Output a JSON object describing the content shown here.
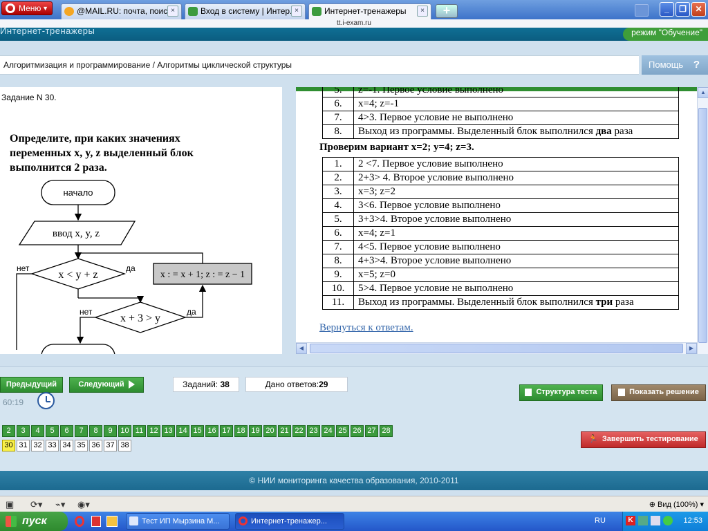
{
  "browser": {
    "menu_label": "Меню",
    "tabs": [
      {
        "label": "@MAIL.RU: почта, поис...",
        "close": "×"
      },
      {
        "label": "Вход в систему | Интер...",
        "close": "×"
      },
      {
        "label": "Интернет-тренажеры",
        "close": "×"
      }
    ],
    "new_tab_label": "+",
    "address": "tt.i-exam.ru",
    "window_buttons": [
      "_",
      "❐",
      "✕"
    ]
  },
  "site": {
    "title": "Интернет-тренажеры",
    "mode": "режим \"Обучение\"",
    "breadcrumb": "Алгоритмизация и программирование / Алгоритмы циклической структуры",
    "help_label": "Помощь",
    "help_mark": "?"
  },
  "task": {
    "number": "Задание N 30.",
    "question": "Определите, при каких значениях переменных x, y, z выделенный блок выполнится 2 раза.",
    "flowchart": {
      "start": "начало",
      "input": "ввод  x, y, z",
      "cond1": "x < y + z",
      "cond2": "x + 3 > y",
      "action": "x : = x + 1; z : = z − 1",
      "no1": "нет",
      "yes1": "да",
      "no2": "нет",
      "yes2": "да"
    }
  },
  "solution": {
    "table1": [
      {
        "n": "6.",
        "text": "x=4; z=-1"
      },
      {
        "n": "7.",
        "text": "4>3. Первое условие не выполнено"
      },
      {
        "n": "8.",
        "text": "Выход из программы. Выделенный блок выполнился ",
        "bold": "два",
        "after": " раза"
      }
    ],
    "variant_heading": "Проверим вариант x=2; y=4; z=3.",
    "table2": [
      {
        "n": "1.",
        "text": "2 <7. Первое условие выполнено"
      },
      {
        "n": "2.",
        "text": "2+3> 4. Второе условие выполнено"
      },
      {
        "n": "3.",
        "text": "x=3; z=2"
      },
      {
        "n": "4.",
        "text": "3<6. Первое условие выполнено"
      },
      {
        "n": "5.",
        "text": "3+3>4. Второе условие выполнено"
      },
      {
        "n": "6.",
        "text": "x=4; z=1"
      },
      {
        "n": "7.",
        "text": "4<5. Первое условие выполнено"
      },
      {
        "n": "8.",
        "text": "4+3>4. Второе условие выполнено"
      },
      {
        "n": "9.",
        "text": "x=5; z=0"
      },
      {
        "n": "10.",
        "text": "5>4. Первое условие не выполнено"
      },
      {
        "n": "11.",
        "text": "Выход из программы. Выделенный блок выполнился ",
        "bold": "три",
        "after": "  раза"
      }
    ],
    "back_link": "Вернуться к ответам."
  },
  "controls": {
    "prev_label": "Предыдущий",
    "next_label": "Следующий",
    "tasks_label": "Заданий: ",
    "tasks_count": "38",
    "answers_label": "Дано ответов:",
    "answers_count": "29",
    "timer": "60:19",
    "structure_label": "Структура теста",
    "solution_label": "Показать решение",
    "finish_label": "Завершить тестирование",
    "row1_numbers": [
      "2",
      "3",
      "4",
      "5",
      "6",
      "7",
      "8",
      "9",
      "10",
      "11",
      "12",
      "13",
      "14",
      "15",
      "16",
      "17",
      "18",
      "19",
      "20",
      "21",
      "22",
      "23",
      "24",
      "25",
      "26",
      "27",
      "28"
    ],
    "row2_numbers": [
      "30",
      "31",
      "32",
      "33",
      "34",
      "35",
      "36",
      "37",
      "38"
    ],
    "current_question": "30"
  },
  "footer": {
    "copyright": "© НИИ мониторинга качества образования, 2010-2011"
  },
  "statusbar": {
    "zoom": "Вид (100%)"
  },
  "taskbar": {
    "start_label": "пуск",
    "items": [
      "Тест ИП Мырзина М...",
      "Интернет-тренажер..."
    ],
    "lang": "RU",
    "clock": "12:53"
  },
  "colors": {
    "header_blue": "#0f6f95",
    "green_button": "#3c9b3e",
    "current_yellow": "#f8f04a",
    "finish_red": "#c02a2a"
  }
}
